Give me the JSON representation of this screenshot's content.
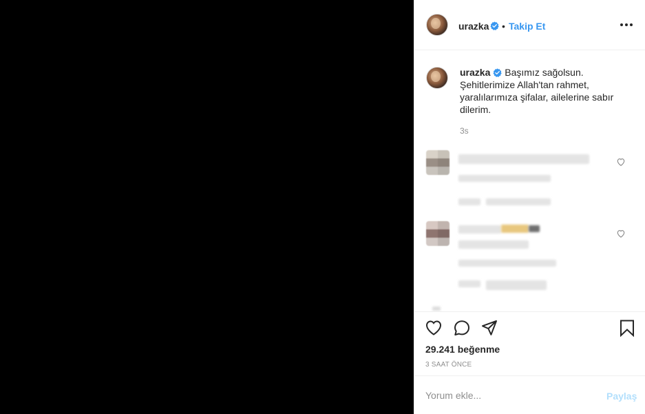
{
  "header": {
    "username": "urazka",
    "separator": "•",
    "follow_label": "Takip Et",
    "verified_icon": "verified-badge-icon",
    "more_icon": "more-options-icon"
  },
  "caption": {
    "username": "urazka",
    "text": "Başımız sağolsun. Şehitlerimize Allah'tan rahmet, yaralılarımıza şifalar, ailelerine sabır dilerim.",
    "time": "3s"
  },
  "actions": {
    "icons": [
      "heart-icon",
      "comment-icon",
      "share-icon",
      "bookmark-icon"
    ],
    "likes": "29.241 beğenme",
    "posted_ago": "3 SAAT ÖNCE"
  },
  "comment_box": {
    "placeholder": "Yorum ekle...",
    "submit_label": "Paylaş"
  },
  "colors": {
    "accent": "#3897f0",
    "verified": "#3897f0",
    "muted": "#8e8e8e",
    "disabled_submit": "#b2dffc",
    "text": "#262626",
    "border": "#efefef"
  }
}
